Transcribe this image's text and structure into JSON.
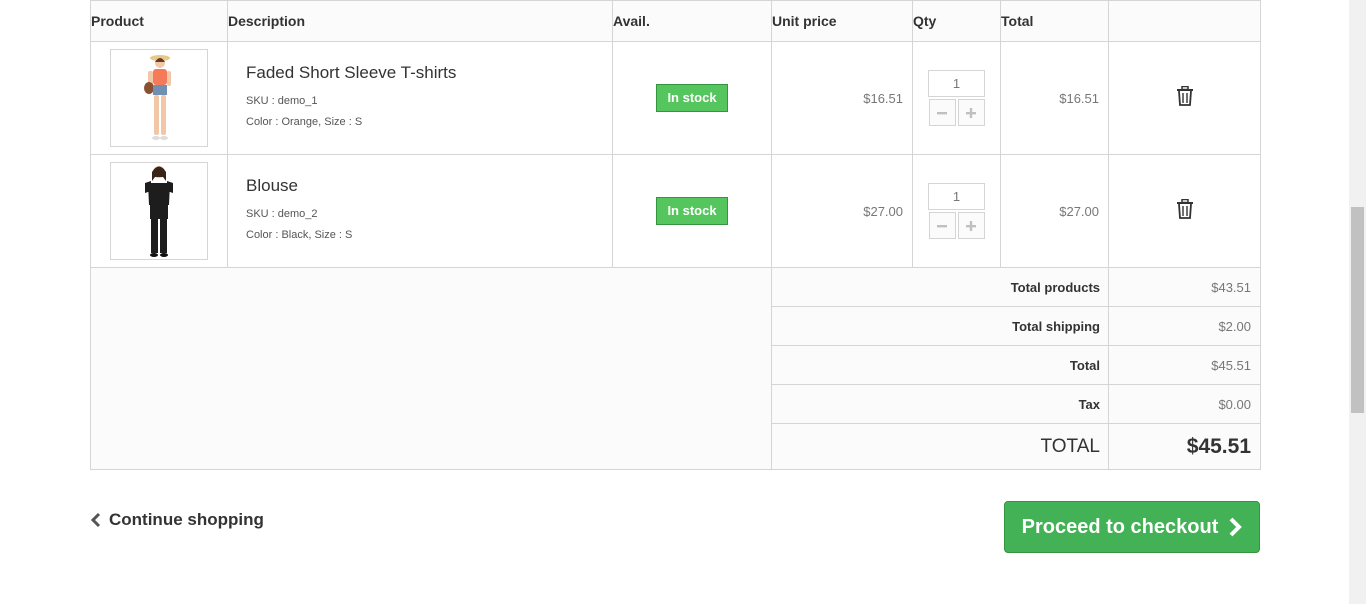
{
  "table": {
    "headers": {
      "product": "Product",
      "description": "Description",
      "avail": "Avail.",
      "unit_price": "Unit price",
      "qty": "Qty",
      "total": "Total"
    },
    "items": [
      {
        "name": "Faded Short Sleeve T-shirts",
        "sku": "SKU : demo_1",
        "attributes": "Color : Orange, Size : S",
        "availability": "In stock",
        "unit_price": "$16.51",
        "qty": "1",
        "total": "$16.51"
      },
      {
        "name": "Blouse",
        "sku": "SKU : demo_2",
        "attributes": "Color : Black, Size : S",
        "availability": "In stock",
        "unit_price": "$27.00",
        "qty": "1",
        "total": "$27.00"
      }
    ]
  },
  "summary": {
    "total_products_label": "Total products",
    "total_products": "$43.51",
    "total_shipping_label": "Total shipping",
    "total_shipping": "$2.00",
    "total_label": "Total",
    "total": "$45.51",
    "tax_label": "Tax",
    "tax": "$0.00",
    "grand_total_label": "TOTAL",
    "grand_total": "$45.51"
  },
  "actions": {
    "continue_label": "Continue shopping",
    "checkout_label": "Proceed to checkout"
  },
  "colors": {
    "in_stock": "#55c65e",
    "checkout": "#43b155",
    "border": "#d6d4d4"
  }
}
